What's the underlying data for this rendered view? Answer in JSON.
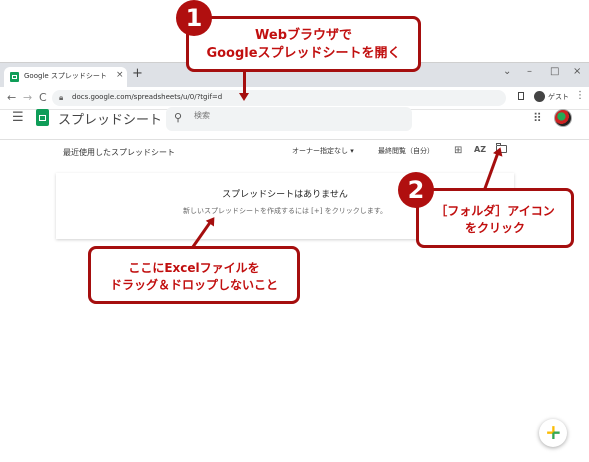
{
  "browser": {
    "tab_title": "Google スプレッドシート",
    "tab_close": "×",
    "new_tab": "+",
    "url": "docs.google.com/spreadsheets/u/0/?tgif=d",
    "guest_label": "ゲスト",
    "window_controls": [
      "⌄",
      "–",
      "□",
      "×"
    ],
    "nav": [
      "←",
      "→",
      "C"
    ]
  },
  "header": {
    "app_title": "スプレッドシート",
    "search_placeholder": "検索"
  },
  "toolbar": {
    "recent_title": "最近使用したスプレッドシート",
    "owner_filter": "オーナー指定なし ▾",
    "sort_label": "最終閲覧（自分）",
    "az_label": "AZ"
  },
  "empty_state": {
    "title": "スプレッドシートはありません",
    "subtitle": "新しいスプレッドシートを作成するには [+] をクリックします。"
  },
  "fab": {
    "label": "+"
  },
  "annotations": {
    "step1_number": "1",
    "step1_line1": "Webブラウザで",
    "step1_line2": "Googleスプレッドシートを開く",
    "step2_number": "2",
    "step2_line1": "［フォルダ］アイコン",
    "step2_line2": "をクリック",
    "note_line1": "ここにExcelファイルを",
    "note_line2": "ドラッグ＆ドロップしないこと",
    "accent_color": "#a50e0e"
  }
}
